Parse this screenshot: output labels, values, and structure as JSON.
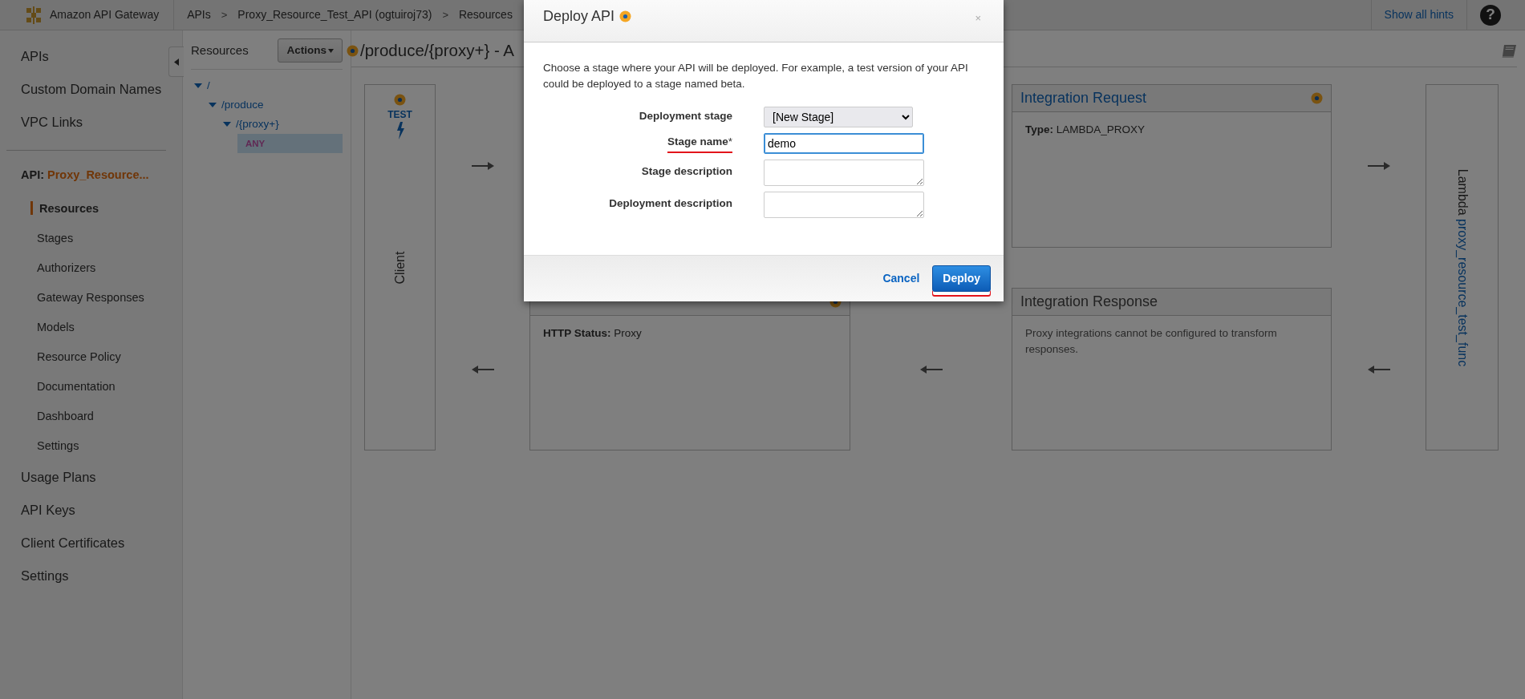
{
  "top_bar": {
    "product": "Amazon API Gateway",
    "breadcrumbs": [
      {
        "kind": "link",
        "text": "APIs"
      },
      {
        "kind": "separator",
        "text": ">"
      },
      {
        "kind": "link",
        "text": "Proxy_Resource_Test_API (ogtuiroj73)"
      },
      {
        "kind": "separator",
        "text": ">"
      },
      {
        "kind": "link",
        "text": "Resources"
      }
    ],
    "hints_link": "Show all hints",
    "help": "?"
  },
  "sidebar": {
    "top_items": [
      "APIs",
      "Custom Domain Names",
      "VPC Links"
    ],
    "api_label": "API:",
    "api_name": "Proxy_Resource...",
    "sub_items": [
      {
        "label": "Resources",
        "selected": true
      },
      {
        "label": "Stages",
        "selected": false
      },
      {
        "label": "Authorizers",
        "selected": false
      },
      {
        "label": "Gateway Responses",
        "selected": false
      },
      {
        "label": "Models",
        "selected": false
      },
      {
        "label": "Resource Policy",
        "selected": false
      },
      {
        "label": "Documentation",
        "selected": false
      },
      {
        "label": "Dashboard",
        "selected": false
      },
      {
        "label": "Settings",
        "selected": false
      }
    ],
    "bottom_items": [
      "Usage Plans",
      "API Keys",
      "Client Certificates",
      "Settings"
    ]
  },
  "resources": {
    "title": "Resources",
    "actions": "Actions",
    "tree": [
      {
        "label": "/",
        "kind": "path",
        "selected": false,
        "expanded": true,
        "children": [
          {
            "label": "/produce",
            "kind": "path",
            "selected": false,
            "expanded": true,
            "children": [
              {
                "label": "/{proxy+}",
                "kind": "path",
                "selected": false,
                "expanded": true,
                "children": [
                  {
                    "label": "ANY",
                    "kind": "method",
                    "selected": true
                  }
                ]
              }
            ]
          }
        ]
      }
    ]
  },
  "page_title": "/produce/{proxy+} - A",
  "diagram": {
    "client": {
      "test_label": "TEST",
      "label": "Client"
    },
    "method_response": {
      "field_label": "HTTP Status:",
      "field_value": "Proxy"
    },
    "integration_request": {
      "title": "Integration Request",
      "field_label": "Type:",
      "field_value": "LAMBDA_PROXY"
    },
    "integration_response": {
      "title": "Integration Response",
      "text": "Proxy integrations cannot be configured to transform responses."
    },
    "lambda": {
      "prefix": "Lambda",
      "link": "proxy_resource_test_func"
    }
  },
  "modal": {
    "title": "Deploy API",
    "close": "×",
    "description": "Choose a stage where your API will be deployed. For example, a test version of your API could be deployed to a stage named beta.",
    "fields": [
      {
        "kind": "select",
        "label": "Deployment stage",
        "value": "[New Stage]",
        "highlighted": false
      },
      {
        "kind": "text",
        "label": "Stage name",
        "required_mark": "*",
        "value": "demo",
        "focused": true,
        "highlighted": true
      },
      {
        "kind": "textarea",
        "label": "Stage description",
        "highlighted": false
      },
      {
        "kind": "textarea",
        "label": "Deployment description",
        "highlighted": false
      }
    ],
    "cancel": "Cancel",
    "deploy": {
      "label": "Deploy",
      "highlighted": true
    }
  }
}
